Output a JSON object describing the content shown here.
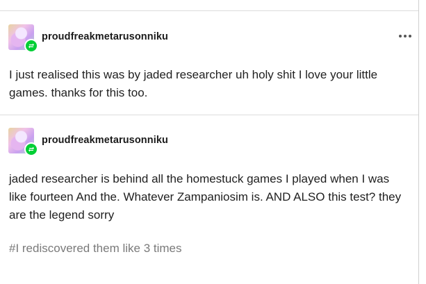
{
  "colors": {
    "reblog_badge": "#00cf35",
    "divider": "#dcdcdc",
    "tag_text": "#7a7a7a"
  },
  "posts": [
    {
      "author": "proudfreakmetarusonniku",
      "avatar_badge_icon": "reblog-icon",
      "menu_icon": "more-options-icon",
      "text": "I just realised this was by jaded researcher uh holy shit I love your little games. thanks for this too."
    },
    {
      "author": "proudfreakmetarusonniku",
      "avatar_badge_icon": "reblog-icon",
      "text": "jaded researcher is behind all the homestuck games I played when I was like fourteen And the. Whatever Zampaniosim is. AND ALSO this test? they are the legend sorry",
      "tags": [
        "#I rediscovered them like 3 times"
      ]
    }
  ]
}
